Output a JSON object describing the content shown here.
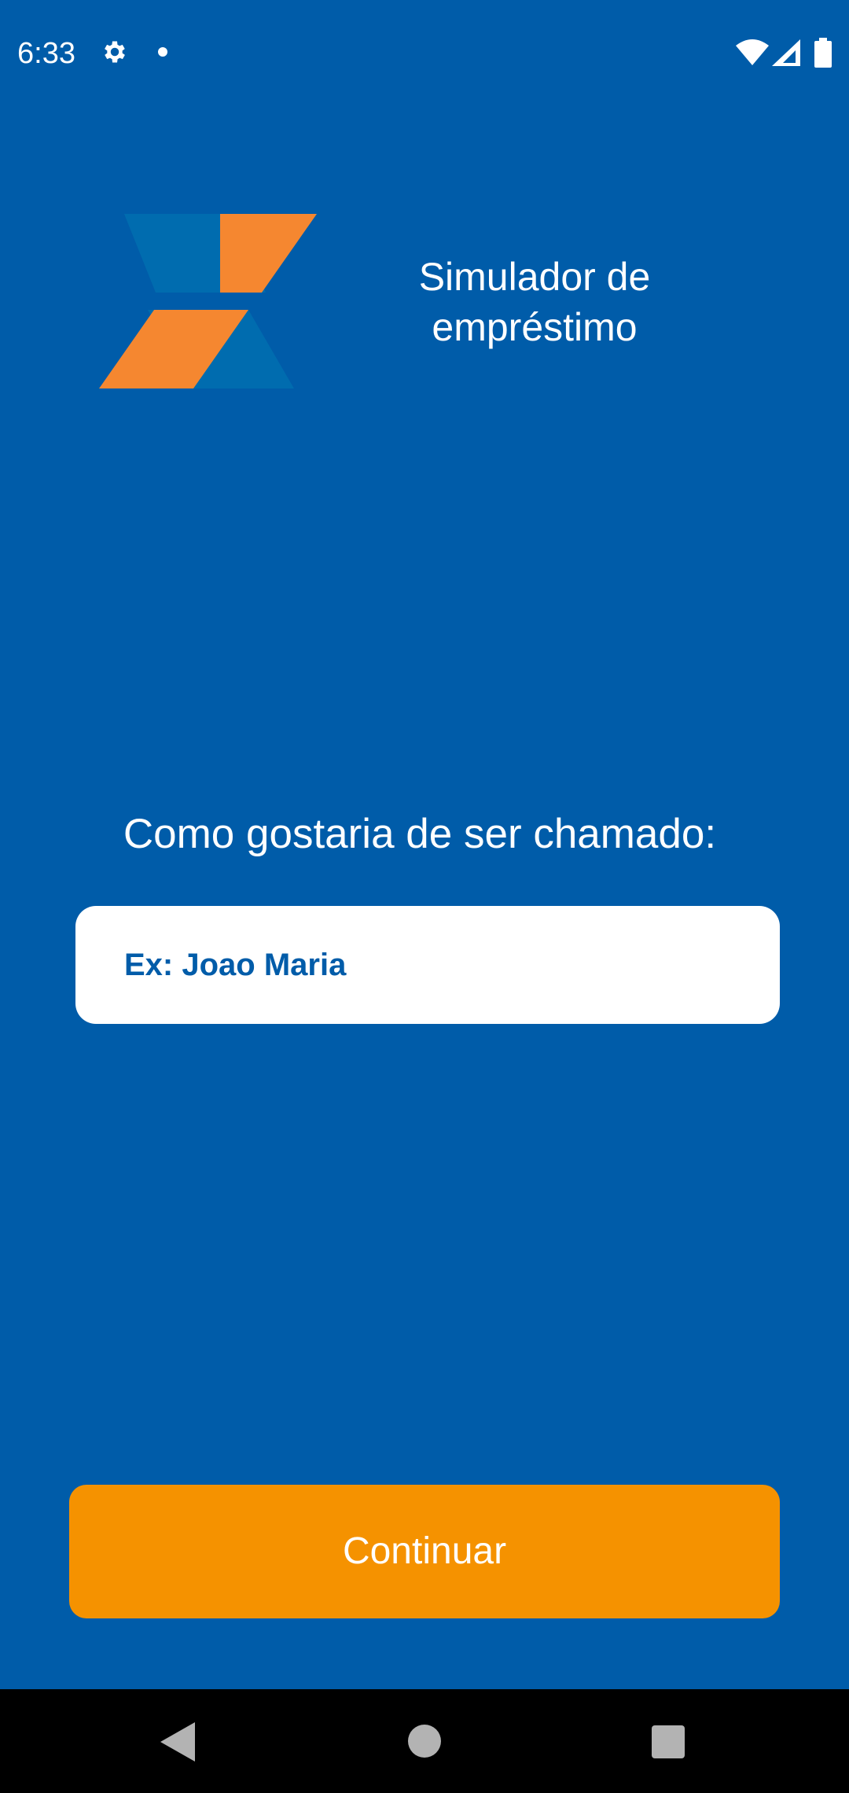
{
  "status_bar": {
    "time": "6:33",
    "icons": [
      "gear-icon",
      "notification-dot-icon",
      "wifi-icon",
      "cell-signal-icon",
      "battery-icon"
    ]
  },
  "header": {
    "logo": "caixa-x-logo",
    "title": "Simulador de\nempréstimo"
  },
  "form": {
    "question": "Como gostaria de ser chamado:",
    "name_input": {
      "value": "",
      "placeholder": "Ex: Joao Maria"
    }
  },
  "actions": {
    "continue_label": "Continuar"
  },
  "navigation_bar": {
    "icons": [
      "back-icon",
      "home-icon",
      "recents-icon"
    ]
  },
  "colors": {
    "background": "#005CA9",
    "accent_orange": "#F59200",
    "logo_orange": "#F58730",
    "logo_blue": "#006CAF",
    "white": "#FFFFFF"
  }
}
